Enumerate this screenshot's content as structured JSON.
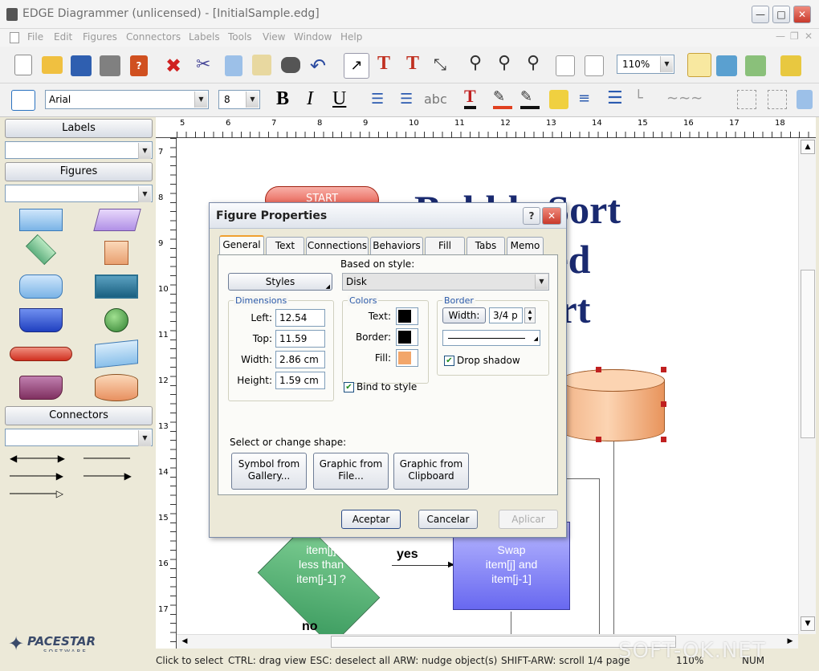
{
  "window": {
    "title": "EDGE Diagrammer (unlicensed) - [InitialSample.edg]"
  },
  "menu": [
    "File",
    "Edit",
    "Figures",
    "Connectors",
    "Labels",
    "Tools",
    "View",
    "Window",
    "Help"
  ],
  "toolbar": {
    "zoom": "110%"
  },
  "format": {
    "font": "Arial",
    "size": "8",
    "bold": "B",
    "italic": "I",
    "underline": "U",
    "abc": "abc"
  },
  "panel": {
    "labels": "Labels",
    "figures": "Figures",
    "connectors": "Connectors"
  },
  "ruler": {
    "top": [
      "5",
      "6",
      "7",
      "8",
      "9",
      "10",
      "11",
      "12",
      "13",
      "14",
      "15",
      "16",
      "17",
      "18"
    ],
    "left": [
      "7",
      "8",
      "9",
      "10",
      "11",
      "12",
      "13",
      "14",
      "15",
      "16",
      "17"
    ]
  },
  "diagram": {
    "start": "START",
    "title_lines": [
      "Bubble Sort",
      "Simplified",
      "Flowchart"
    ],
    "decision": "item[j]\nless than\nitem[j-1] ?",
    "yes": "yes",
    "no": "no",
    "swap": "Swap\nitem[j] and\nitem[j-1]"
  },
  "dialog": {
    "title": "Figure Properties",
    "help": "?",
    "tabs": [
      "General",
      "Text",
      "Connections",
      "Behaviors",
      "Fill",
      "Tabs",
      "Memo"
    ],
    "based_on_label": "Based on style:",
    "styles_btn": "Styles",
    "style_value": "Disk",
    "dimensions": {
      "title": "Dimensions",
      "left_label": "Left:",
      "left": "12.54 cm",
      "top_label": "Top:",
      "top": "11.59 cm",
      "width_label": "Width:",
      "width": "2.86 cm",
      "height_label": "Height:",
      "height": "1.59 cm"
    },
    "colors": {
      "title": "Colors",
      "text_label": "Text:",
      "border_label": "Border:",
      "fill_label": "Fill:",
      "text_color": "#000000",
      "border_color": "#000000",
      "fill_color": "#f2a66a"
    },
    "border": {
      "title": "Border",
      "width_btn": "Width:",
      "width_value": "3/4 p",
      "drop_shadow": "Drop shadow"
    },
    "bind_to_style": "Bind to style",
    "shape_label": "Select or change shape:",
    "shape_btns": [
      "Symbol from Gallery...",
      "Graphic from File...",
      "Graphic from Clipboard"
    ],
    "ok": "Aceptar",
    "cancel": "Cancelar",
    "apply": "Aplicar"
  },
  "status": {
    "click": "Click to select",
    "ctrl": "CTRL: drag view",
    "esc": "ESC: deselect all",
    "arw": "ARW: nudge object(s)",
    "shift": "SHIFT-ARW: scroll 1/4 page",
    "zoom": "110%",
    "num": "NUM"
  },
  "brand": {
    "logo": "PACESTAR",
    "sub": "SOFTWARE"
  },
  "watermark": "SOFT-OK.NET"
}
